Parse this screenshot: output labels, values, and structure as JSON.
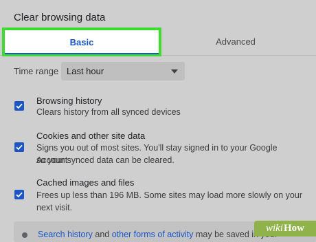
{
  "dialog": {
    "title": "Clear browsing data"
  },
  "tabs": [
    {
      "label": "Basic",
      "selected": true
    },
    {
      "label": "Advanced",
      "selected": false
    }
  ],
  "time_range": {
    "label": "Time range",
    "value": "Last hour"
  },
  "items": [
    {
      "title": "Browsing history",
      "description": "Clears history from all synced devices",
      "checked": true
    },
    {
      "title": "Cookies and other site data",
      "description_line1": "Signs you out of most sites. You'll stay signed in to your Google Account",
      "description_line2": "so your synced data can be cleared.",
      "checked": true
    },
    {
      "title": "Cached images and files",
      "description_line1": "Frees up less than 196 MB. Some sites may load more slowly on your",
      "description_line2": "next visit.",
      "checked": true
    }
  ],
  "notice": {
    "link1": "Search history",
    "text1": " and ",
    "link2": "other forms of activity",
    "text2": " may be saved in your"
  },
  "watermark": {
    "wiki": "wiki",
    "how": "How"
  },
  "colors": {
    "accent": "#1a56c4",
    "highlight": "#3ddc2f",
    "background": "#cfcfcf"
  },
  "icons": {
    "checkbox": "check-icon",
    "dropdown": "caret-down-icon"
  }
}
